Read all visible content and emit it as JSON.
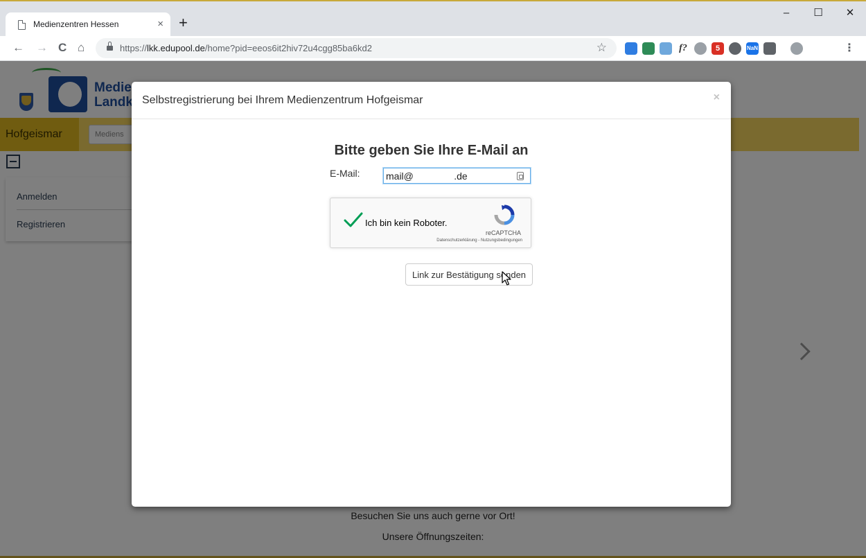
{
  "browser": {
    "tab_title": "Medienzentren Hessen",
    "tab_close": "×",
    "new_tab": "+",
    "window_controls": {
      "minimize": "–",
      "maximize": "☐",
      "close": "✕"
    },
    "nav": {
      "back": "←",
      "forward": "→",
      "reload": "C",
      "home": "⌂"
    },
    "url_scheme": "https://",
    "url_host": "lkk.edupool.de",
    "url_path": "/home?pid=eeos6it2hiv72u4cgg85ba6kd2",
    "bookmark_star": "☆",
    "extension_texts": {
      "f": "f?",
      "five": "5",
      "nan": "NaN"
    },
    "menu": "⋮"
  },
  "page": {
    "logo_line1": "Medie",
    "logo_line2": "Landkr",
    "location": "Hofgeismar",
    "search_placeholder": "Mediens",
    "sidebar": {
      "login": "Anmelden",
      "register": "Registrieren"
    },
    "footer_line1": "Besuchen Sie uns auch gerne vor Ort!",
    "footer_line2": "Unsere Öffnungszeiten:"
  },
  "modal": {
    "title": "Selbstregistrierung bei Ihrem Medienzentrum Hofgeismar",
    "close": "×",
    "heading": "Bitte geben Sie Ihre E-Mail an",
    "email_label": "E-Mail:",
    "email_value": "mail@               .de",
    "recaptcha": {
      "label": "Ich bin kein Roboter.",
      "brand": "reCAPTCHA",
      "links": "Datenschutzerklärung - Nutzungsbedingungen"
    },
    "submit_label": "Link zur Bestätigung senden"
  }
}
